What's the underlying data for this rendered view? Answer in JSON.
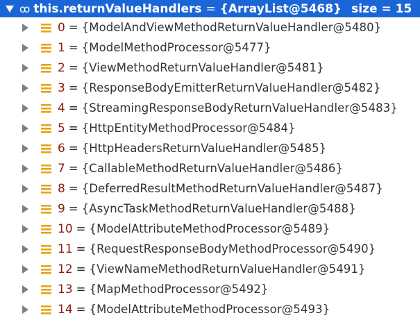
{
  "header": {
    "icon": "watch-glasses-icon",
    "name": "this.returnValueHandlers",
    "equals": "=",
    "value": "{ArrayList@5468}",
    "size": "size = 15",
    "bg_color": "#1b66d6"
  },
  "items": [
    {
      "index": "0",
      "value": "{ModelAndViewMethodReturnValueHandler@5480}"
    },
    {
      "index": "1",
      "value": "{ModelMethodProcessor@5477}"
    },
    {
      "index": "2",
      "value": "{ViewMethodReturnValueHandler@5481}"
    },
    {
      "index": "3",
      "value": "{ResponseBodyEmitterReturnValueHandler@5482}"
    },
    {
      "index": "4",
      "value": "{StreamingResponseBodyReturnValueHandler@5483}"
    },
    {
      "index": "5",
      "value": "{HttpEntityMethodProcessor@5484}"
    },
    {
      "index": "6",
      "value": "{HttpHeadersReturnValueHandler@5485}"
    },
    {
      "index": "7",
      "value": "{CallableMethodReturnValueHandler@5486}"
    },
    {
      "index": "8",
      "value": "{DeferredResultMethodReturnValueHandler@5487}"
    },
    {
      "index": "9",
      "value": "{AsyncTaskMethodReturnValueHandler@5488}"
    },
    {
      "index": "10",
      "value": "{ModelAttributeMethodProcessor@5489}"
    },
    {
      "index": "11",
      "value": "{RequestResponseBodyMethodProcessor@5490}"
    },
    {
      "index": "12",
      "value": "{ViewNameMethodReturnValueHandler@5491}"
    },
    {
      "index": "13",
      "value": "{MapMethodProcessor@5492}"
    },
    {
      "index": "14",
      "value": "{ModelAttributeMethodProcessor@5493}"
    }
  ],
  "colors": {
    "field_icon": "#e8a317",
    "index": "#8b1a10",
    "arrow": "#7f7f7f"
  },
  "row_icon": "field-lines-icon",
  "expand_icon": "expand-arrow-icon"
}
